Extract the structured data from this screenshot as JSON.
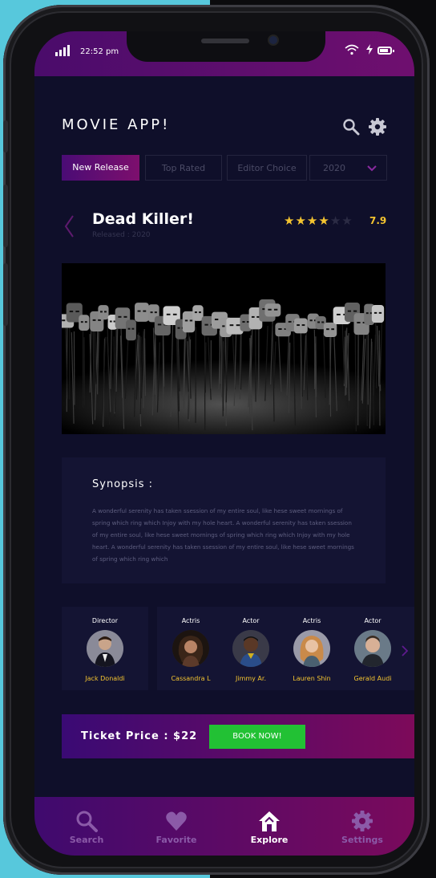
{
  "status": {
    "time": "22:52 pm"
  },
  "header": {
    "title": "MOVIE APP!"
  },
  "tabs": [
    {
      "label": "New Release",
      "active": true
    },
    {
      "label": "Top Rated",
      "active": false
    },
    {
      "label": "Editor Choice",
      "active": false
    },
    {
      "label": "2020",
      "active": false,
      "dropdown": true
    }
  ],
  "movie": {
    "title": "Dead Killer!",
    "released": "Released : 2020",
    "stars_filled": 4,
    "stars_total": 6,
    "rating": "7.9"
  },
  "synopsis": {
    "title": "Synopsis :",
    "text": "A wonderful serenity has taken ssession of my entire soul, like hese sweet mornings of spring which ring which Injoy with my hole heart. A wonderful serenity has taken ssession of my entire soul, like hese sweet mornings of spring which ring which Injoy with my hole heart. A wonderful serenity has taken ssession of my entire soul, like hese sweet mornings of spring which ring which"
  },
  "cast": [
    {
      "role": "Director",
      "name": "Jack Donaldi"
    },
    {
      "role": "Actris",
      "name": "Cassandra L"
    },
    {
      "role": "Actor",
      "name": "Jimmy Ar."
    },
    {
      "role": "Actris",
      "name": "Lauren Shin"
    },
    {
      "role": "Actor",
      "name": "Gerald Audi"
    }
  ],
  "ticket": {
    "label": "Ticket Price : $22",
    "button": "BOOK NOW!"
  },
  "nav": [
    {
      "label": "Search",
      "icon": "search-icon",
      "active": false
    },
    {
      "label": "Favorite",
      "icon": "heart-icon",
      "active": false
    },
    {
      "label": "Explore",
      "icon": "home-icon",
      "active": true
    },
    {
      "label": "Settings",
      "icon": "gear-icon",
      "active": false
    }
  ],
  "colors": {
    "accent": "#f4c430",
    "button": "#22c134",
    "purple": "#4a0c75",
    "magenta": "#7d0f6d"
  }
}
